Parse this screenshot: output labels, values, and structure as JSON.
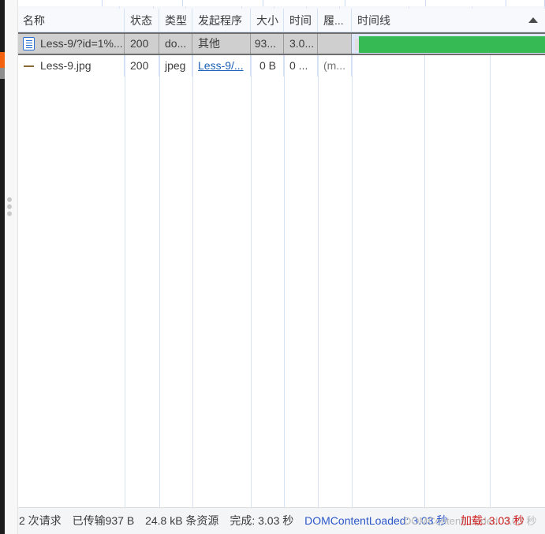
{
  "panel": {
    "title": "network-panel"
  },
  "table": {
    "columns": [
      {
        "key": "name",
        "label": "名称",
        "width": 136,
        "icon": "none"
      },
      {
        "key": "status",
        "label": "状态",
        "width": 44,
        "icon": "none"
      },
      {
        "key": "type",
        "label": "类型",
        "width": 42,
        "icon": "none"
      },
      {
        "key": "initiator",
        "label": "发起程序",
        "width": 74,
        "icon": "none"
      },
      {
        "key": "size",
        "label": "大小",
        "width": 42,
        "icon": "none"
      },
      {
        "key": "time",
        "label": "时间",
        "width": 43,
        "icon": "none"
      },
      {
        "key": "waterfall_h",
        "label": "履...",
        "width": 43,
        "icon": "none"
      },
      {
        "key": "timeline",
        "label": "时间线",
        "width": 0,
        "icon": "sort-caret-up-icon"
      }
    ],
    "rows": [
      {
        "icon": "document-icon",
        "name": "Less-9/?id=1%...",
        "status": "200",
        "type": "do...",
        "initiator": "其他",
        "initiator_is_link": false,
        "size": "93...",
        "time": "3.0...",
        "waterfall_h": "",
        "selected": true,
        "bar": {
          "color": "#35ba54",
          "track": "#dde6f8",
          "connect": "#e0dede"
        }
      },
      {
        "icon": "dash-icon",
        "name": "Less-9.jpg",
        "status": "200",
        "type": "jpeg",
        "initiator": "Less-9/...",
        "initiator_is_link": true,
        "size": "0 B",
        "time": "0  ...",
        "waterfall_h": "(m...",
        "selected": false,
        "bar": null
      }
    ]
  },
  "summary": {
    "requests": "2 次请求",
    "transferred": "已传输937 B",
    "resources": "24.8 kB 条资源",
    "finish": "完成: 3.03 秒",
    "domcontentloaded": "DOMContentLoaded: 3.03 秒",
    "load_ghost": "DOMContentLoaded: 3.03 秒",
    "load": "加载: 3.03 秒"
  },
  "colors": {
    "accent_green": "#35ba54",
    "accent_blue": "#2b57c9",
    "accent_red": "#d32020",
    "selection": "#cfcfcf",
    "grid": "#d5e2f5",
    "browser_orange": "#f4620d"
  }
}
